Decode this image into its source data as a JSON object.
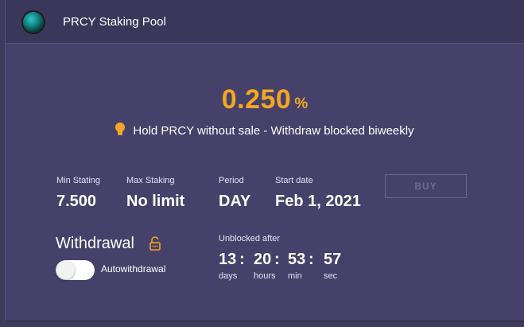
{
  "header": {
    "title": "PRCY Staking Pool",
    "logo_icon": "prcy-globe-logo"
  },
  "rate": {
    "value": "0.250",
    "unit": "%"
  },
  "notice": {
    "text": "Hold PRCY without sale - Withdraw blocked biweekly",
    "icon": "lightbulb-icon"
  },
  "stats": {
    "min_staking": {
      "label": "Min Stating",
      "value": "7.500"
    },
    "max_staking": {
      "label": "Max Staking",
      "value": "No limit"
    },
    "period": {
      "label": "Period",
      "value": "DAY"
    },
    "start_date": {
      "label": "Start date",
      "value": "Feb 1, 2021"
    }
  },
  "buy_button": {
    "label": "BUY",
    "enabled": false
  },
  "withdrawal": {
    "title": "Withdrawal",
    "lock_icon": "unlock-icon",
    "toggle_label": "Autowithdrawal",
    "auto_enabled": false
  },
  "countdown": {
    "label": "Unblocked after",
    "days": "13",
    "hours": "20",
    "min": "53",
    "sec": "57",
    "separator": ":",
    "units": {
      "days": "days",
      "hours": "hours",
      "min": "min",
      "sec": "sec"
    }
  },
  "colors": {
    "accent": "#f5a623",
    "card_bg": "#45416a",
    "header_bg": "#3a375a",
    "page_bg": "#3d3a5c"
  }
}
